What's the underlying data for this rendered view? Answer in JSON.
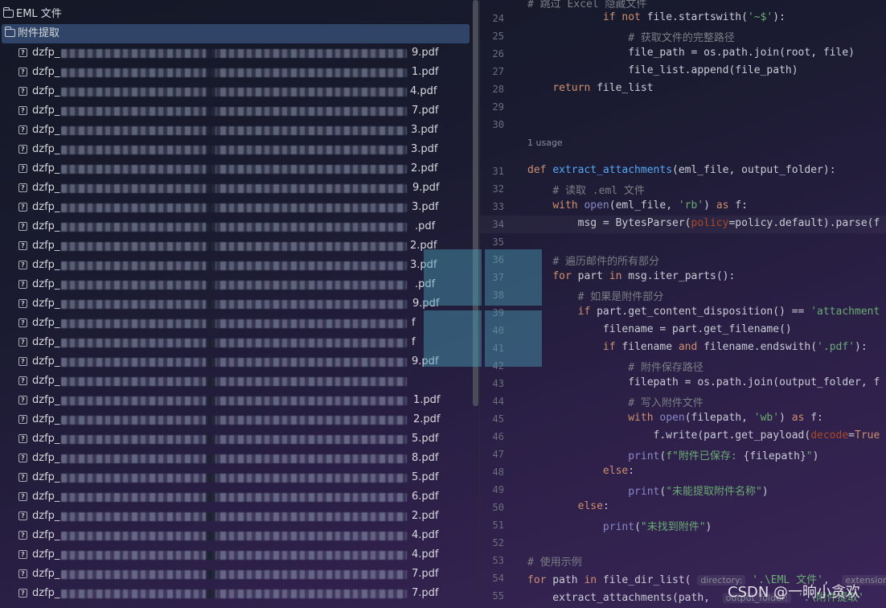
{
  "tree": {
    "folders": [
      "EML 文件",
      "附件提取"
    ],
    "file_prefix": "dzfp_",
    "files": [
      {
        "ext": "9.pdf"
      },
      {
        "ext": "1.pdf"
      },
      {
        "ext": "4.pdf"
      },
      {
        "ext": "7.pdf"
      },
      {
        "ext": "3.pdf"
      },
      {
        "ext": "3.pdf"
      },
      {
        "ext": "2.pdf"
      },
      {
        "ext": "9.pdf"
      },
      {
        "ext": "3.pdf"
      },
      {
        "ext": ".pdf"
      },
      {
        "ext": "2.pdf"
      },
      {
        "ext": "3.pdf"
      },
      {
        "ext": ".pdf"
      },
      {
        "ext": "9.pdf"
      },
      {
        "ext": "f"
      },
      {
        "ext": "f"
      },
      {
        "ext": "9.pdf"
      },
      {
        "ext": ""
      },
      {
        "ext": "1.pdf"
      },
      {
        "ext": "2.pdf"
      },
      {
        "ext": "5.pdf"
      },
      {
        "ext": "8.pdf"
      },
      {
        "ext": "5.pdf"
      },
      {
        "ext": "6.pdf"
      },
      {
        "ext": "2.pdf"
      },
      {
        "ext": "4.pdf"
      },
      {
        "ext": "4.pdf"
      },
      {
        "ext": "7.pdf"
      },
      {
        "ext": "7.pdf"
      }
    ]
  },
  "editor": {
    "usage_hint": "1 usage",
    "lines": [
      {
        "n": "24",
        "html": "            <span class='kw'>if not</span> file.startswith(<span class='str'>'~$'</span>):"
      },
      {
        "n": "25",
        "html": "                <span class='cm'># 获取文件的完整路径</span>"
      },
      {
        "n": "26",
        "html": "                file_path = os.path.join(root, file)"
      },
      {
        "n": "27",
        "html": "                file_list.append(file_path)"
      },
      {
        "n": "28",
        "html": "    <span class='kw'>return</span> file_list"
      },
      {
        "n": "29",
        "html": ""
      },
      {
        "n": "30",
        "html": ""
      },
      {
        "n": "31",
        "html": "<span class='kw'>def</span> <span class='fn'>extract_attachments</span>(eml_file, output_folder):"
      },
      {
        "n": "32",
        "html": "    <span class='cm'># 读取 .eml 文件</span>"
      },
      {
        "n": "33",
        "html": "    <span class='kw'>with</span> <span class='bi'>open</span>(eml_file, <span class='str'>'rb'</span>) <span class='kw'>as</span> f:"
      },
      {
        "n": "34",
        "html": "        msg = BytesParser(<span class='par'>policy</span>=policy.default).parse(f"
      },
      {
        "n": "35",
        "html": ""
      },
      {
        "n": "36",
        "html": "    <span class='cm'># 遍历邮件的所有部分</span>"
      },
      {
        "n": "37",
        "html": "    <span class='kw'>for</span> part <span class='kw'>in</span> msg.iter_parts():"
      },
      {
        "n": "38",
        "html": "        <span class='cm'># 如果是附件部分</span>"
      },
      {
        "n": "39",
        "html": "        <span class='kw'>if</span> part.get_content_disposition() == <span class='str'>'attachment</span>"
      },
      {
        "n": "40",
        "html": "            filename = part.get_filename()"
      },
      {
        "n": "41",
        "html": "            <span class='kw'>if</span> filename <span class='kw'>and</span> filename.endswith(<span class='str'>'.pdf'</span>):"
      },
      {
        "n": "42",
        "html": "                <span class='cm'># 附件保存路径</span>"
      },
      {
        "n": "43",
        "html": "                filepath = os.path.join(output_folder, f"
      },
      {
        "n": "44",
        "html": "                <span class='cm'># 写入附件文件</span>"
      },
      {
        "n": "45",
        "html": "                <span class='kw'>with</span> <span class='bi'>open</span>(filepath, <span class='str'>'wb'</span>) <span class='kw'>as</span> f:"
      },
      {
        "n": "46",
        "html": "                    f.write(part.get_payload(<span class='par'>decode</span>=<span class='kw'>True</span>"
      },
      {
        "n": "47",
        "html": "                <span class='bi'>print</span>(<span class='str'>f\"附件已保存: </span>{filepath}<span class='str'>\"</span>)"
      },
      {
        "n": "48",
        "html": "            <span class='kw'>else</span>:"
      },
      {
        "n": "49",
        "html": "                <span class='bi'>print</span>(<span class='str'>\"未能提取附件名称\"</span>)"
      },
      {
        "n": "50",
        "html": "        <span class='kw'>else</span>:"
      },
      {
        "n": "51",
        "html": "            <span class='bi'>print</span>(<span class='str'>\"未找到附件\"</span>)"
      },
      {
        "n": "52",
        "html": ""
      },
      {
        "n": "53",
        "html": "<span class='cm'># 使用示例</span>"
      },
      {
        "n": "54",
        "html": "<span class='kw'>for</span> path <span class='kw'>in</span> file_dir_list( <span class='hint'>directory:</span> <span class='str'>'.\\EML 文件'</span>,  <span class='hint'>extensions</span>"
      },
      {
        "n": "55",
        "html": "    extract_attachments(path,  <span class='hint'>output_folder:</span> <span class='str'>'.\\附件提取'</span>"
      }
    ],
    "top_comment": "# 跳过 Excel 隐藏文件"
  },
  "watermark": "CSDN @一晌小贪欢",
  "colors": {
    "selection": "#2f4466",
    "keyword": "#cf8e6d",
    "function": "#56a8f5",
    "string": "#6aab73",
    "comment": "#7a7e85"
  }
}
